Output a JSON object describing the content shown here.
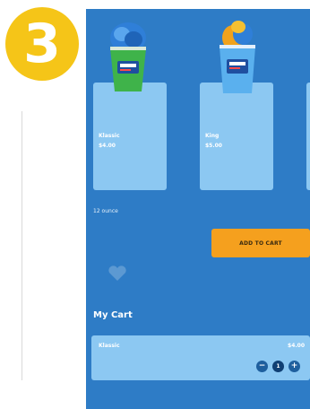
{
  "step": {
    "number": "3",
    "color": "#f5c518"
  },
  "products": [
    {
      "name": "Klassic",
      "price": "$4.00",
      "icon": "shaved-ice-cup-green-icon"
    },
    {
      "name": "King",
      "price": "$5.00",
      "icon": "shaved-ice-cup-blue-icon"
    }
  ],
  "size_label": "12 ounce",
  "add_to_cart_label": "ADD TO CART",
  "cart": {
    "title": "My Cart",
    "items": [
      {
        "name": "Klassic",
        "price": "$4.00",
        "quantity": "1"
      }
    ]
  },
  "colors": {
    "panel": "#2e7cc6",
    "card": "#8cc8f2",
    "accent": "#f5a01e"
  }
}
